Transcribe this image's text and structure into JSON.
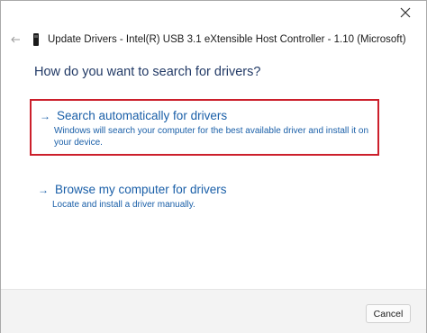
{
  "window": {
    "title": "Update Drivers - Intel(R) USB 3.1 eXtensible Host Controller - 1.10 (Microsoft)"
  },
  "icons": {
    "close": "close-icon",
    "back": "back-arrow-icon",
    "device": "usb-device-icon",
    "option_arrow": "arrow-right-icon"
  },
  "main": {
    "question": "How do you want to search for drivers?",
    "options": [
      {
        "arrow": "→",
        "title": "Search automatically for drivers",
        "description": "Windows will search your computer for the best available driver and install it on your device.",
        "highlighted": true
      },
      {
        "arrow": "→",
        "title": "Browse my computer for drivers",
        "description": "Locate and install a driver manually.",
        "highlighted": false
      }
    ]
  },
  "footer": {
    "cancel_label": "Cancel"
  },
  "colors": {
    "link": "#1a5fa8",
    "highlight_border": "#cc1f2b",
    "heading": "#223a66",
    "footer_bg": "#f3f3f3"
  }
}
